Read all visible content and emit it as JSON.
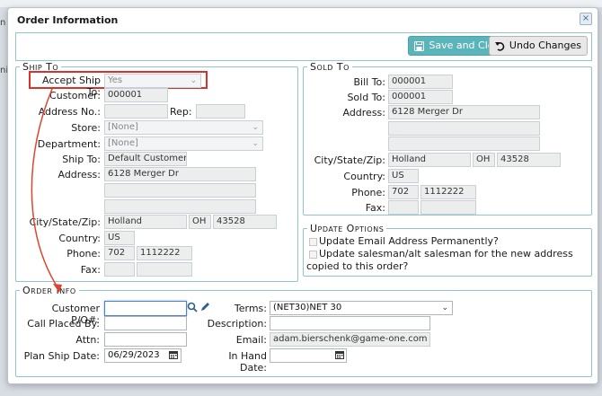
{
  "dialog": {
    "title": "Order Information",
    "close_glyph": "×"
  },
  "toolbar": {
    "save_label": "Save and Close",
    "undo_label": "Undo Changes"
  },
  "ship_to": {
    "legend": "Ship To",
    "accept_label": "Accept Ship To:",
    "accept_value": "Yes",
    "customer_label": "Customer:",
    "customer_value": "000001",
    "address_no_label": "Address No.:",
    "address_no_value": "",
    "rep_label": "Rep:",
    "rep_value": "",
    "store_label": "Store:",
    "store_value": "[None]",
    "department_label": "Department:",
    "department_value": "[None]",
    "ship_to_label": "Ship To:",
    "ship_to_value": "Default Customer",
    "address_label": "Address:",
    "address_line1": "6128 Merger Dr",
    "address_line2": "",
    "address_line3": "",
    "csz_label": "City/State/Zip:",
    "city": "Holland",
    "state": "OH",
    "zip": "43528",
    "country_label": "Country:",
    "country_value": "US",
    "phone_label": "Phone:",
    "phone_area": "702",
    "phone_number": "1112222",
    "fax_label": "Fax:",
    "fax_area": "",
    "fax_number": ""
  },
  "sold_to": {
    "legend": "Sold To",
    "bill_to_label": "Bill To:",
    "bill_to_value": "000001",
    "sold_to_label": "Sold To:",
    "sold_to_value": "000001",
    "address_label": "Address:",
    "address_line1": "6128 Merger Dr",
    "address_line2": "",
    "address_line3": "",
    "csz_label": "City/State/Zip:",
    "city": "Holland",
    "state": "OH",
    "zip": "43528",
    "country_label": "Country:",
    "country_value": "US",
    "phone_label": "Phone:",
    "phone_area": "702",
    "phone_number": "1112222",
    "fax_label": "Fax:",
    "fax_area": "",
    "fax_number": ""
  },
  "update_options": {
    "legend": "Update Options",
    "option1": "Update Email Address Permanently?",
    "option2": "Update salesman/alt salesman for the new address copied to this order?"
  },
  "order_info": {
    "legend": "Order Info",
    "po_label": "Customer P/O#:",
    "po_value": "",
    "call_placed_label": "Call Placed By:",
    "call_placed_value": "",
    "attn_label": "Attn:",
    "attn_value": "",
    "plan_ship_label": "Plan Ship Date:",
    "plan_ship_value": "06/29/2023",
    "terms_label": "Terms:",
    "terms_value": "(NET30)NET 30",
    "description_label": "Description:",
    "description_value": "",
    "email_label": "Email:",
    "email_value": "adam.bierschenk@game-one.com",
    "in_hand_label": "In Hand Date:",
    "in_hand_value": ""
  },
  "background": {
    "left_tab": "n",
    "left_tab2": "ni"
  },
  "colors": {
    "accent": "#5bb4b9",
    "fieldset_border": "#8fc6cc",
    "highlight": "#d9322b",
    "arrow": "#e0442e"
  },
  "icons": [
    "close-icon",
    "save-icon",
    "undo-icon",
    "search-icon",
    "pencil-icon",
    "calendar-icon",
    "chevron-down-icon"
  ]
}
